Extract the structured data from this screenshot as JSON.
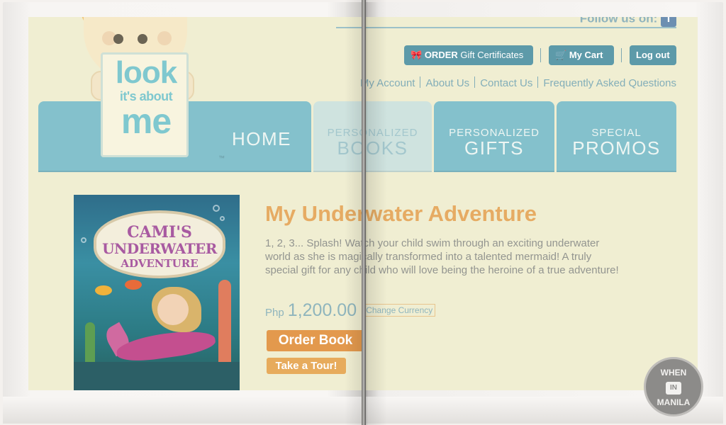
{
  "header": {
    "follow_text": "Follow us on:",
    "follow_icon": "facebook-icon",
    "order_button": {
      "strong": "ORDER",
      "rest": "Gift Certificates",
      "icon": "ribbon-icon"
    },
    "cart_button": {
      "label": "My Cart",
      "icon": "cart-icon"
    },
    "logout_button": "Log out",
    "links": [
      "My Account",
      "About Us",
      "Contact Us",
      "Frequently Asked Questions"
    ]
  },
  "logo": {
    "line1": "look",
    "line2": "it's about",
    "line3": "me",
    "tm": "™"
  },
  "nav": {
    "home": "HOME",
    "books": {
      "small": "PERSONALIZED",
      "big": "BOOKS"
    },
    "gifts": {
      "small": "PERSONALIZED",
      "big": "GIFTS"
    },
    "promos": {
      "small": "SPECIAL",
      "big": "PROMOS"
    }
  },
  "product": {
    "cover": {
      "line1": "CAMI'S",
      "line2": "UNDERWATER",
      "line3": "ADVENTURE"
    },
    "title": "My Underwater Adventure",
    "description": "1, 2, 3... Splash! Watch your child swim through an exciting underwater world as she is magically transformed into a talented mermaid! A truly special gift for any child who will love being the heroine of a true adventure!",
    "currency": "Php",
    "price": "1,200.00",
    "change_currency": "Change Currency",
    "order_book": "Order Book",
    "take_tour": "Take a Tour!"
  },
  "watermark": {
    "line1": "WHEN",
    "line2": "IN",
    "line3": "MANILA"
  },
  "colors": {
    "accent_teal": "#84c1cc",
    "button_teal": "#5d9aa9",
    "title_orange": "#e6ab63",
    "order_orange": "#e3994d"
  }
}
